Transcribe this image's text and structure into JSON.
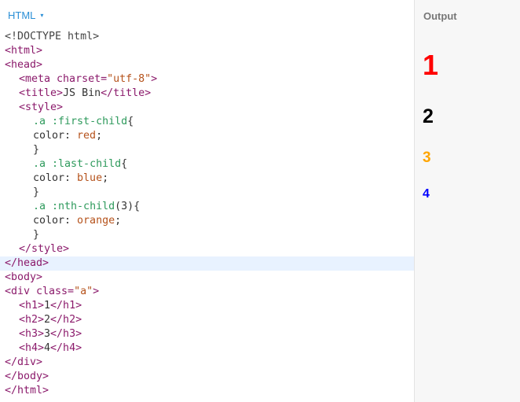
{
  "editor": {
    "label": "HTML",
    "caret": "▾"
  },
  "code": {
    "l1": "<!DOCTYPE html>",
    "l2": "<html>",
    "l3": "<head>",
    "l4_a": "<meta ",
    "l4_b": "charset=",
    "l4_c": "\"utf-8\"",
    "l4_d": ">",
    "l5_a": "<title>",
    "l5_b": "JS Bin",
    "l5_c": "</title>",
    "l6": "<style>",
    "l7_a": ".a ",
    "l7_b": ":first-child",
    "l7_c": "{",
    "l8_a": "color: ",
    "l8_b": "red",
    "l8_c": ";",
    "l9": "}",
    "l10_a": ".a ",
    "l10_b": ":last-child",
    "l10_c": "{",
    "l11_a": "color: ",
    "l11_b": "blue",
    "l11_c": ";",
    "l12": "}",
    "l13_a": ".a ",
    "l13_b": ":nth-child",
    "l13_c": "(3){",
    "l14_a": "color: ",
    "l14_b": "orange",
    "l14_c": ";",
    "l15": "}",
    "l16": "</style>",
    "l17": "</head>",
    "l18": "<body>",
    "l19_a": "<div ",
    "l19_b": "class=",
    "l19_c": "\"a\"",
    "l19_d": ">",
    "l20_a": "<h1>",
    "l20_b": "1",
    "l20_c": "</h1>",
    "l21_a": "<h2>",
    "l21_b": "2",
    "l21_c": "</h2>",
    "l22_a": "<h3>",
    "l22_b": "3",
    "l22_c": "</h3>",
    "l23_a": "<h4>",
    "l23_b": "4",
    "l23_c": "</h4>",
    "l24": "</div>",
    "l25": "</body>",
    "l26": "</html>"
  },
  "output": {
    "title": "Output",
    "h1": "1",
    "h2": "2",
    "h3": "3",
    "h4": "4"
  },
  "colors": {
    "label": "#2a8fd6",
    "active_line": "#e8f2ff",
    "output_bg": "#f7f7f7"
  }
}
